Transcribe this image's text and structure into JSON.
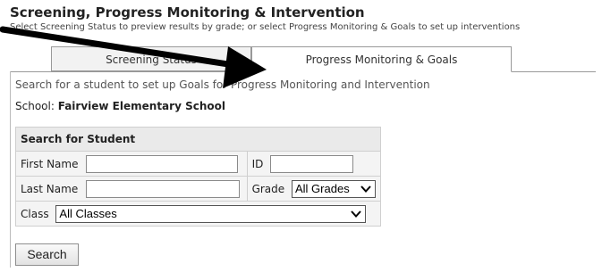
{
  "header": {
    "title": "Screening, Progress Monitoring & Intervention",
    "subtitle": "Select Screening Status to preview results by grade; or select Progress Monitoring & Goals to set up interventions"
  },
  "tabs": [
    {
      "label": "Screening Status",
      "active": false
    },
    {
      "label": "Progress Monitoring & Goals",
      "active": true
    }
  ],
  "main": {
    "hint": "Search for a student to set up Goals for Progress Monitoring and Intervention",
    "school_label": "School:",
    "school_name": "Fairview Elementary School"
  },
  "search_form": {
    "heading": "Search for Student",
    "first_name_label": "First Name",
    "first_name_value": "",
    "id_label": "ID",
    "id_value": "",
    "last_name_label": "Last Name",
    "last_name_value": "",
    "grade_label": "Grade",
    "grade_value": "All Grades",
    "class_label": "Class",
    "class_value": "All Classes",
    "search_button": "Search"
  },
  "colors": {
    "arrow": "#000000",
    "tab_border": "#999999",
    "table_bg": "#f4f4f4"
  },
  "icons": {
    "dropdown": "chevron-down-icon",
    "annotation": "arrow-icon"
  }
}
